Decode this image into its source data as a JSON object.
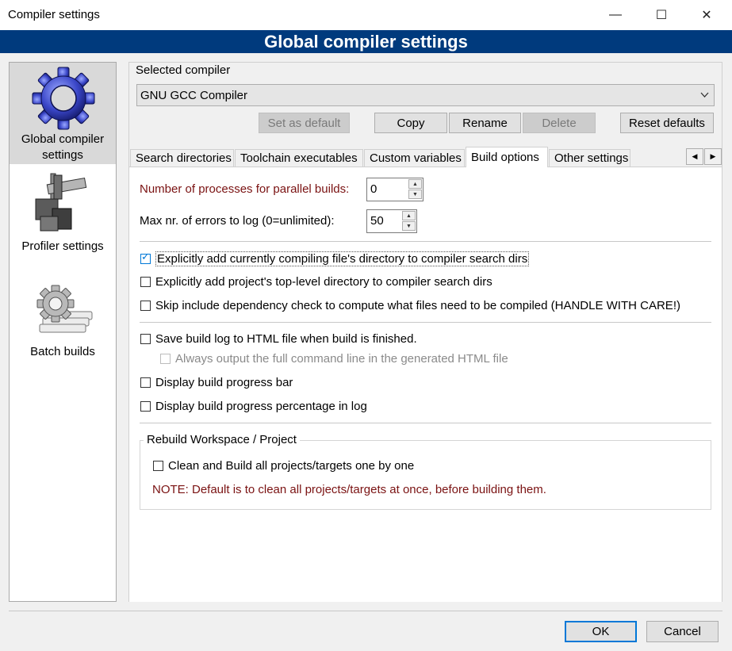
{
  "window": {
    "title": "Compiler settings",
    "minimize_glyph": "—",
    "maximize_glyph": "☐",
    "close_glyph": "✕"
  },
  "banner": {
    "title": "Global compiler settings"
  },
  "sidebar": {
    "items": [
      {
        "label_line1": "Global compiler",
        "label_line2": "settings",
        "icon": "gear-icon"
      },
      {
        "label_line1": "Profiler settings",
        "icon": "caliper-icon"
      },
      {
        "label_line1": "Batch builds",
        "icon": "gear-stack-icon"
      }
    ]
  },
  "compiler": {
    "section_label": "Selected compiler",
    "selected": "GNU GCC Compiler",
    "buttons": {
      "set_default": "Set as default",
      "copy": "Copy",
      "rename": "Rename",
      "delete": "Delete",
      "reset": "Reset defaults"
    }
  },
  "tabs": [
    "Search directories",
    "Toolchain executables",
    "Custom variables",
    "Build options",
    "Other settings"
  ],
  "tab_scroll": {
    "left": "◀",
    "right": "▶"
  },
  "build_options": {
    "parallel_label": "Number of processes for parallel builds:",
    "parallel_value": "0",
    "errors_label": "Max nr. of errors to log (0=unlimited):",
    "errors_value": "50",
    "checks": [
      {
        "label": "Explicitly add currently compiling file's directory to compiler search dirs",
        "checked": true
      },
      {
        "label": "Explicitly add project's top-level directory to compiler search dirs",
        "checked": false
      },
      {
        "label": "Skip include dependency check to compute what files need to be compiled (HANDLE WITH CARE!)",
        "checked": false
      },
      {
        "label": "Save build log to HTML file when build is finished.",
        "checked": false
      },
      {
        "label": "Always output the full command line in the generated HTML file",
        "checked": false,
        "disabled": true
      },
      {
        "label": "Display build progress bar",
        "checked": false
      },
      {
        "label": "Display build progress percentage in log",
        "checked": false
      }
    ],
    "rebuild": {
      "group_label": "Rebuild Workspace / Project",
      "check_label": "Clean and Build all projects/targets one by one",
      "note": "NOTE: Default is to clean all projects/targets at once, before building them."
    }
  },
  "footer": {
    "ok": "OK",
    "cancel": "Cancel"
  }
}
